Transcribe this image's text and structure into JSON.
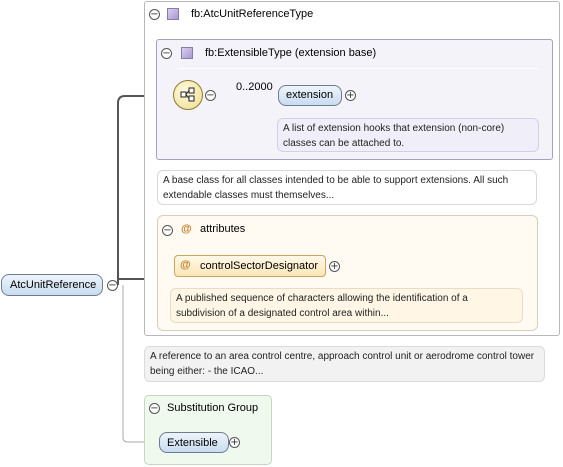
{
  "complex_type": {
    "name": "fb:AtcUnitReferenceType"
  },
  "extension_base": {
    "name": "fb:ExtensibleType (extension base)"
  },
  "sequence": {
    "occurrence": "0..2000"
  },
  "extension_element": {
    "name": "extension",
    "doc": "A list of extension hooks that extension (non-core) classes can be attached to."
  },
  "type_doc": "A base class for all classes intended to be able to support extensions. All such extendable classes must themselves...",
  "attributes": {
    "title": "attributes",
    "symbol": "@",
    "items": [
      {
        "name": "controlSectorDesignator",
        "doc": "A published sequence of characters allowing the identification of a subdivision of a designated control area within..."
      }
    ]
  },
  "root": {
    "name": "AtcUnitReference",
    "doc": "A reference to an area control centre, approach control unit or aerodrome control tower being either: - the ICAO..."
  },
  "substitution_group": {
    "title": "Substitution Group",
    "items": [
      {
        "name": "Extensible"
      }
    ]
  },
  "colors": {
    "element_fill": "#c8dcf0",
    "extension_box": "#f5f3fa",
    "attributes_box": "#fffaf2",
    "substitution_box": "#f0f9ee"
  }
}
